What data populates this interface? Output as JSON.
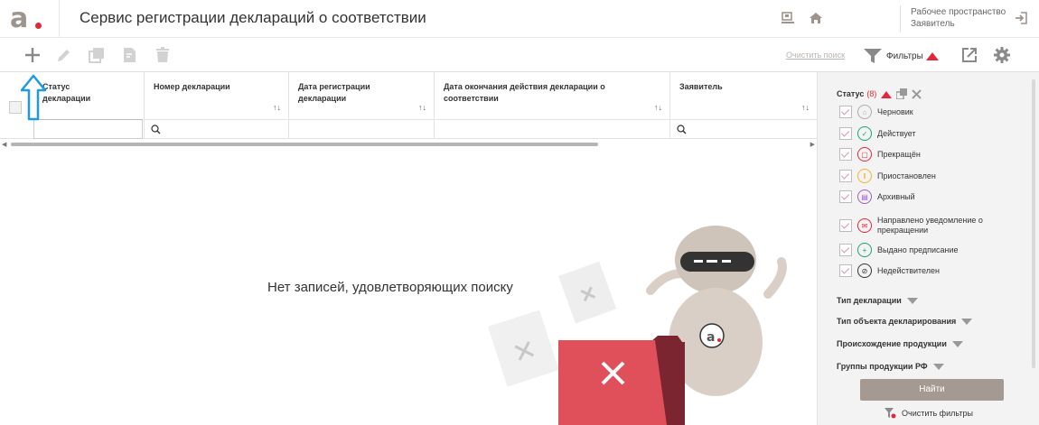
{
  "header": {
    "title": "Сервис регистрации деклараций о соответствии",
    "workspace_line1": "Рабочее пространство",
    "workspace_line2": "Заявитель"
  },
  "toolbar": {
    "clear_search": "Очистить поиск",
    "filters": "Фильтры"
  },
  "table": {
    "columns": [
      {
        "label_line1": "Статус",
        "label_line2": "декларации",
        "sortable": false
      },
      {
        "label_line1": "Номер декларации",
        "label_line2": "",
        "sortable": true
      },
      {
        "label_line1": "Дата регистрации",
        "label_line2": "декларации",
        "sortable": true
      },
      {
        "label_line1": "Дата окончания действия декларации о",
        "label_line2": "соответствии",
        "sortable": true
      },
      {
        "label_line1": "Заявитель",
        "label_line2": "",
        "sortable": true
      }
    ],
    "sort_glyph": "↑↓",
    "empty_message": "Нет записей, удовлетворяющих поиску"
  },
  "filters_panel": {
    "status_title": "Статус",
    "status_count": "(8)",
    "statuses": [
      {
        "label": "Черновик",
        "color": "#b0aaa5",
        "icon": "draft-icon"
      },
      {
        "label": "Действует",
        "color": "#1aa36f",
        "icon": "check-icon"
      },
      {
        "label": "Прекращён",
        "color": "#e0293c",
        "icon": "stop-icon"
      },
      {
        "label": "Приостановлен",
        "color": "#f0b429",
        "icon": "pause-icon"
      },
      {
        "label": "Архивный",
        "color": "#a05cc7",
        "icon": "archive-icon"
      },
      {
        "label_line1": "Направлено уведомление о",
        "label_line2": "прекращении",
        "color": "#e0293c",
        "icon": "mail-icon"
      },
      {
        "label": "Выдано предписание",
        "color": "#1aa36f",
        "icon": "plus-circle-icon"
      },
      {
        "label": "Недействителен",
        "color": "#333333",
        "icon": "invalid-icon"
      }
    ],
    "groups": [
      "Тип декларации",
      "Тип объекта декларирования",
      "Происхождение продукции",
      "Группы продукции РФ"
    ],
    "find_button": "Найти",
    "clear_filters": "Очистить фильтры"
  },
  "colors": {
    "accent_red": "#e0293c",
    "brand_gray": "#a59a91",
    "annotation_blue": "#1e9be0"
  }
}
